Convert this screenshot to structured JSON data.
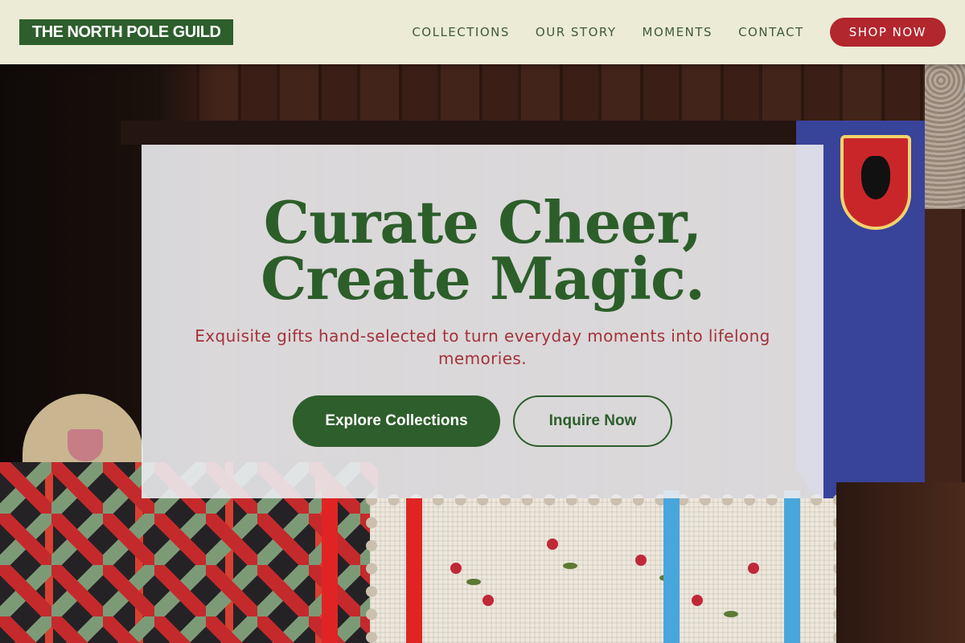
{
  "brand": {
    "name": "THE NORTH POLE GUILD"
  },
  "nav": {
    "links": [
      "COLLECTIONS",
      "OUR STORY",
      "MOMENTS",
      "CONTACT"
    ],
    "cta": "SHOP NOW"
  },
  "hero": {
    "title_line1": "Curate Cheer,",
    "title_line2": "Create Magic.",
    "subtitle": "Exquisite gifts hand-selected to turn everyday moments into lifelong memories.",
    "primary_button": "Explore Collections",
    "secondary_button": "Inquire Now"
  },
  "colors": {
    "brand_green": "#2d5e2b",
    "accent_red": "#b2262e",
    "nav_bg": "#ecebd5"
  }
}
